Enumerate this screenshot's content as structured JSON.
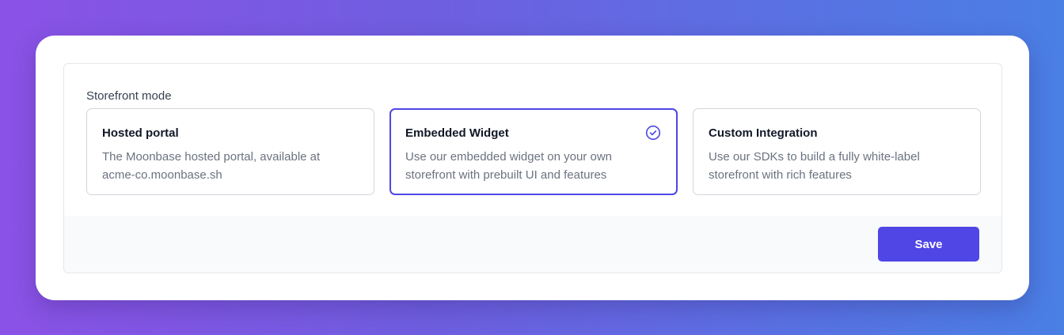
{
  "storefront": {
    "label": "Storefront mode",
    "options": [
      {
        "title": "Hosted portal",
        "description": "The Moonbase hosted portal, available at acme-co.moonbase.sh",
        "selected": false
      },
      {
        "title": "Embedded Widget",
        "description": "Use our embedded widget on your own storefront with prebuilt UI and features",
        "selected": true
      },
      {
        "title": "Custom Integration",
        "description": "Use our SDKs to build a fully white-label storefront with rich features",
        "selected": false
      }
    ]
  },
  "footer": {
    "save_label": "Save"
  },
  "colors": {
    "accent": "#4f46e5",
    "background_start": "#8b52e6",
    "background_end": "#4a7fe4"
  },
  "icons": {
    "selected_indicator": "check-circle-icon"
  }
}
